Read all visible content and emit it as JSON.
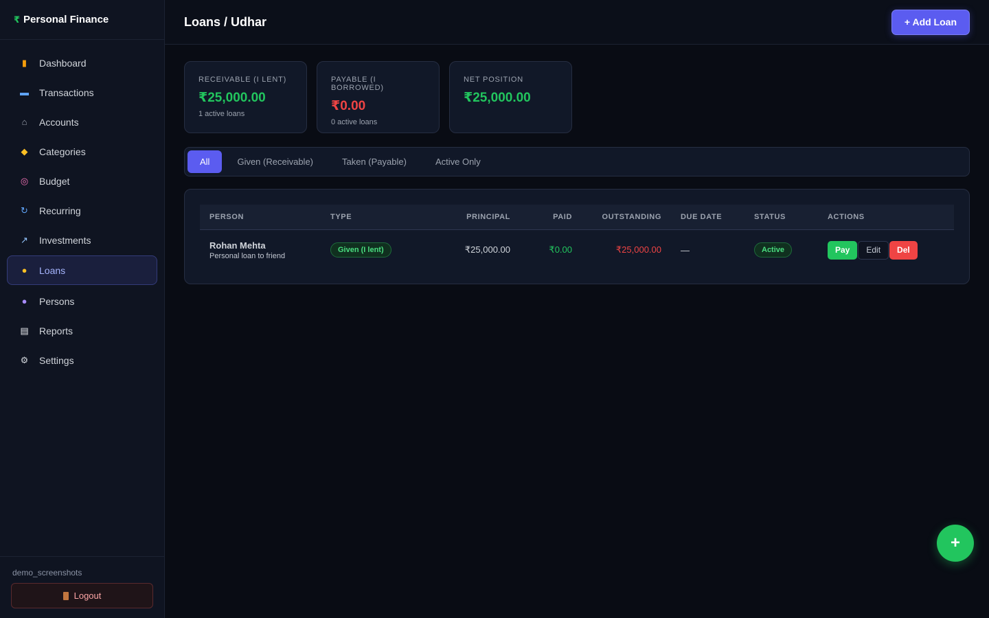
{
  "brand": {
    "icon": "₹",
    "name": "Personal Finance"
  },
  "sidebar": {
    "items": [
      {
        "label": "Dashboard",
        "icon": "bar-chart-icon",
        "glyph": "▮",
        "color": "#f59e0b"
      },
      {
        "label": "Transactions",
        "icon": "credit-card-icon",
        "glyph": "▬",
        "color": "#60a5fa"
      },
      {
        "label": "Accounts",
        "icon": "bank-icon",
        "glyph": "⌂",
        "color": "#9ca3af"
      },
      {
        "label": "Categories",
        "icon": "tag-icon",
        "glyph": "◆",
        "color": "#fbbf24"
      },
      {
        "label": "Budget",
        "icon": "target-icon",
        "glyph": "◎",
        "color": "#f472b6"
      },
      {
        "label": "Recurring",
        "icon": "repeat-icon",
        "glyph": "↻",
        "color": "#60a5fa"
      },
      {
        "label": "Investments",
        "icon": "trend-chart-icon",
        "glyph": "↗",
        "color": "#93c5fd"
      },
      {
        "label": "Loans",
        "icon": "handshake-icon",
        "glyph": "●",
        "color": "#fbbf24",
        "active": true
      },
      {
        "label": "Persons",
        "icon": "person-icon",
        "glyph": "●",
        "color": "#a78bfa"
      },
      {
        "label": "Reports",
        "icon": "clipboard-icon",
        "glyph": "▤",
        "color": "#e5e7eb"
      },
      {
        "label": "Settings",
        "icon": "gear-icon",
        "glyph": "⚙",
        "color": "#d1d5db"
      }
    ],
    "username": "demo_screenshots",
    "logout_label": "Logout"
  },
  "header": {
    "title": "Loans / Udhar",
    "add_button_label": "+ Add Loan"
  },
  "summary": [
    {
      "label": "Receivable (I lent)",
      "value": "₹25,000.00",
      "sub": "1 active loans",
      "color": "#22c55e"
    },
    {
      "label": "Payable (I borrowed)",
      "value": "₹0.00",
      "sub": "0 active loans",
      "color": "#ef4444"
    },
    {
      "label": "Net Position",
      "value": "₹25,000.00",
      "sub": "",
      "color": "#22c55e"
    }
  ],
  "tabs": [
    {
      "label": "All",
      "active": true
    },
    {
      "label": "Given (Receivable)"
    },
    {
      "label": "Taken (Payable)"
    },
    {
      "label": "Active Only"
    }
  ],
  "table": {
    "columns": [
      "Person",
      "Type",
      "Principal",
      "Paid",
      "Outstanding",
      "Due Date",
      "Status",
      "Actions"
    ],
    "rows": [
      {
        "person": "Rohan Mehta",
        "note": "Personal loan to friend",
        "type": "Given (I lent)",
        "principal": "₹25,000.00",
        "paid": "₹0.00",
        "outstanding": "₹25,000.00",
        "due_date": "—",
        "status": "Active",
        "actions": {
          "pay": "Pay",
          "edit": "Edit",
          "del": "Del"
        }
      }
    ]
  },
  "fab_label": "+"
}
